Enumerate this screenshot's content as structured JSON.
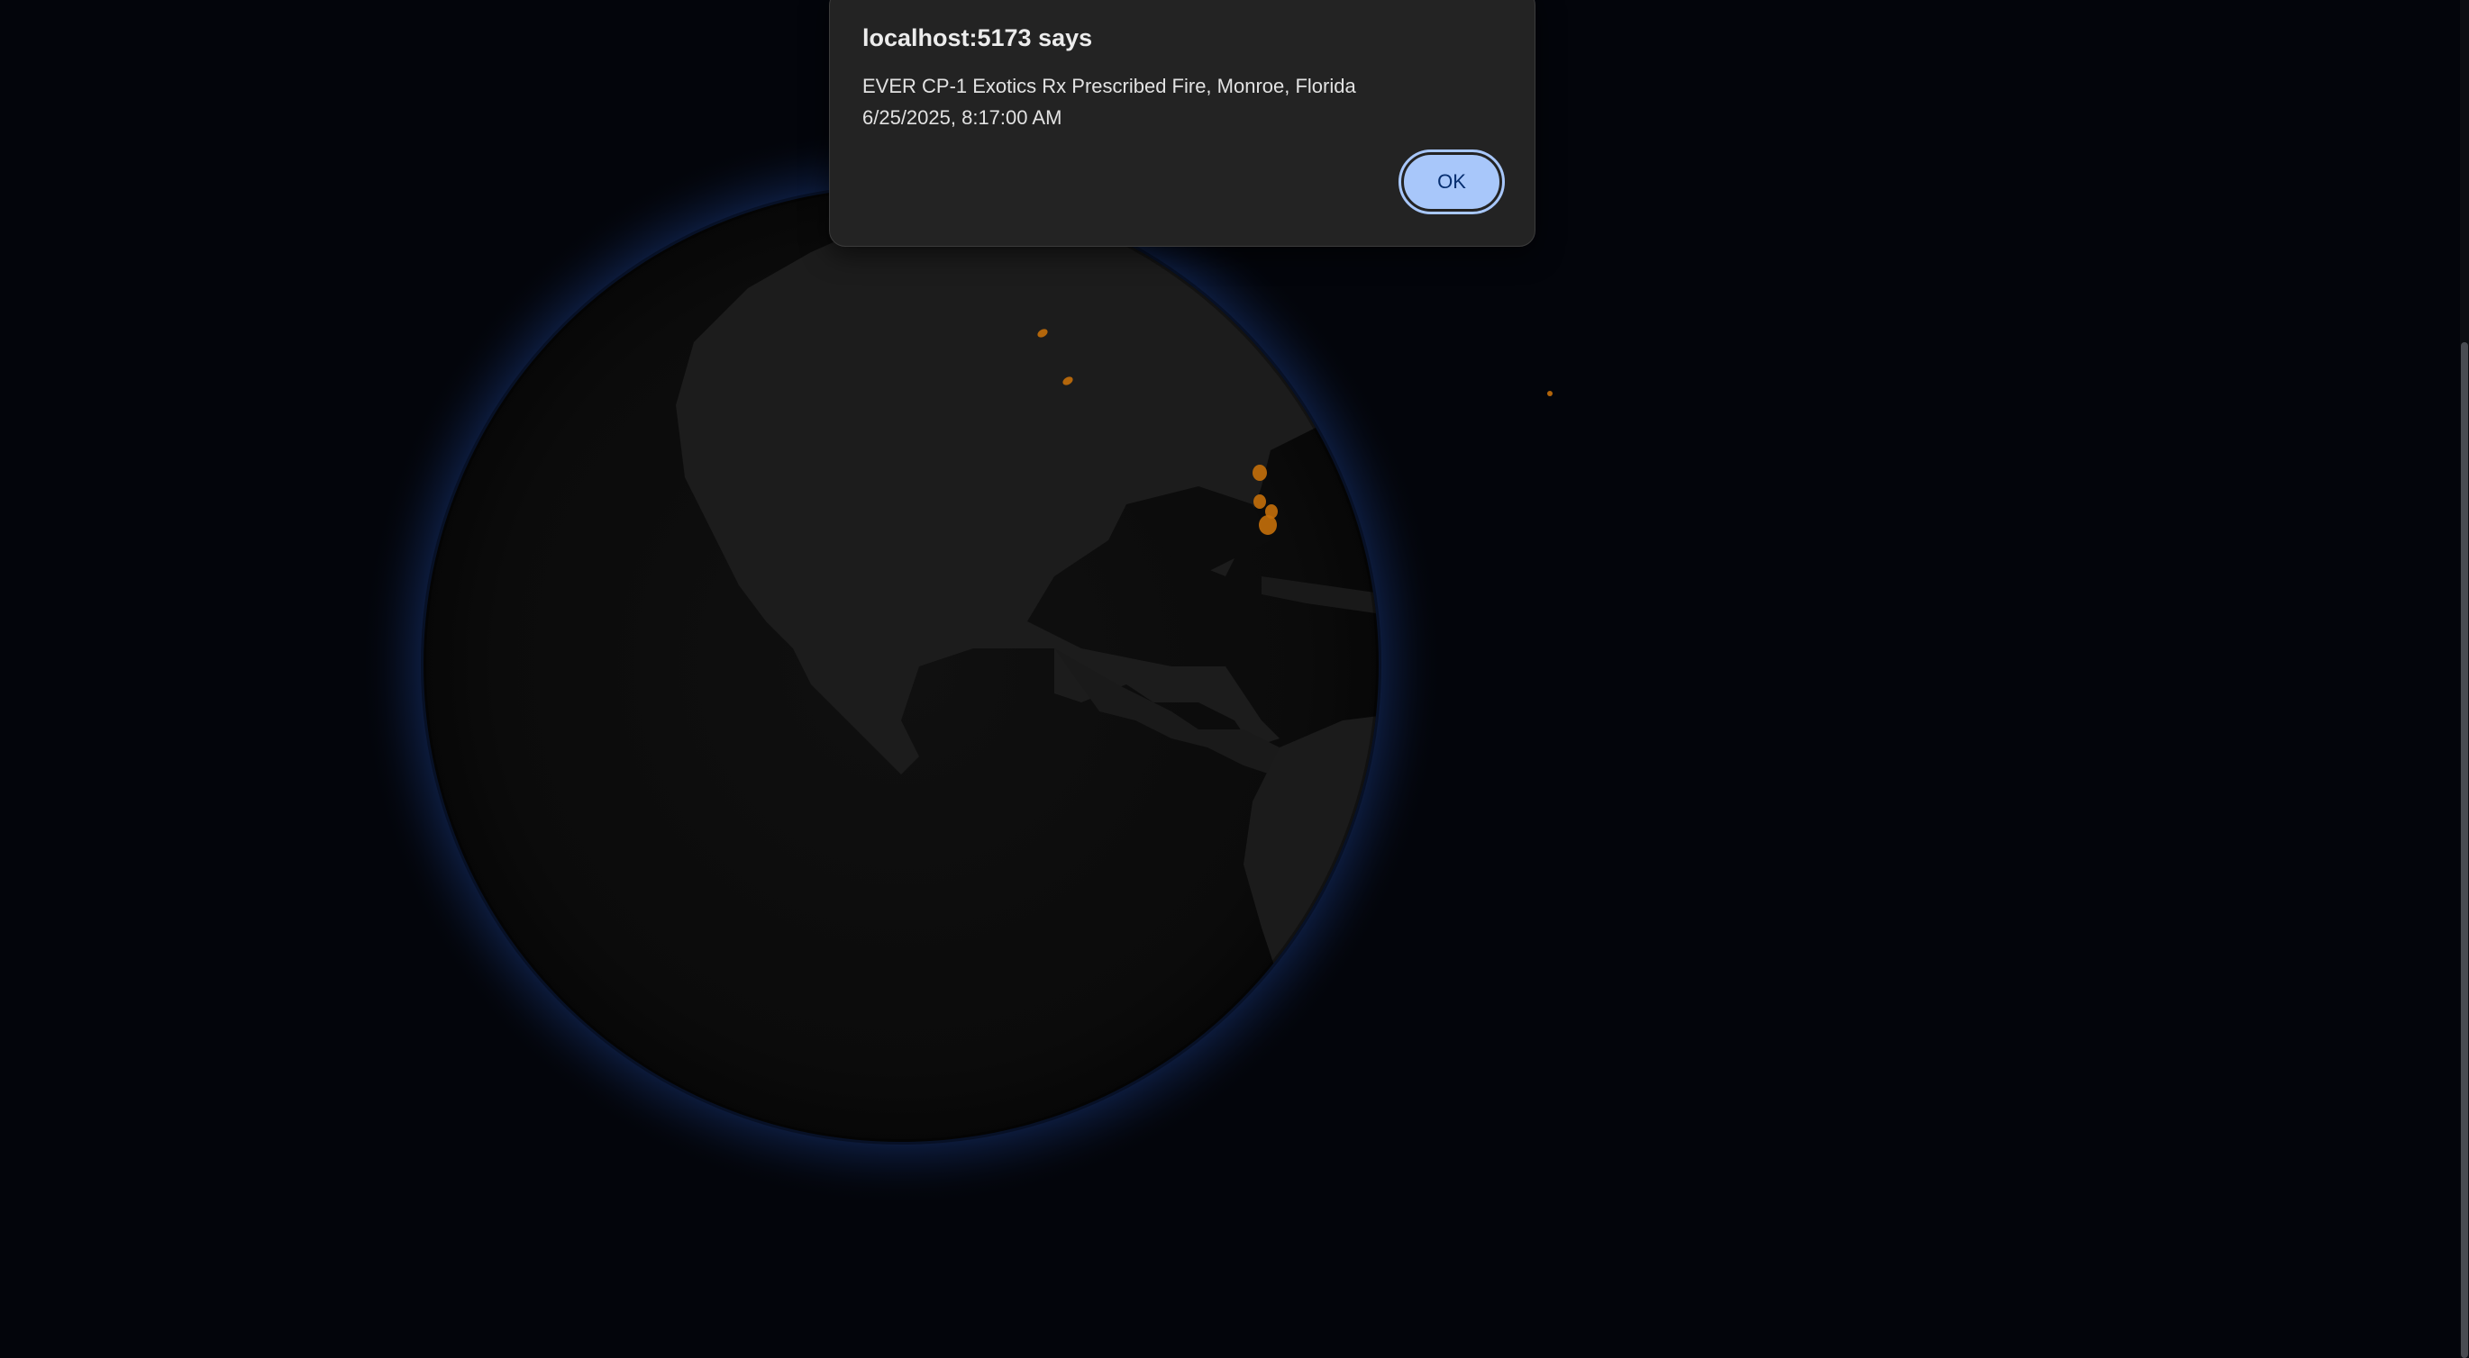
{
  "dialog": {
    "title": "localhost:5173 says",
    "message_line1": "EVER CP-1 Exotics Rx Prescribed Fire, Monroe, Florida",
    "message_line2": "6/25/2025, 8:17:00 AM",
    "ok_label": "OK"
  },
  "colors": {
    "background": "#03050b",
    "globe_ocean": "#0b0b0b",
    "globe_land": "#1d1d1d",
    "atmosphere": "#1b3e8a",
    "fire_marker": "#c46f0a",
    "dialog_bg": "#232323",
    "ok_button": "#a8c7fa"
  },
  "globe": {
    "fire_markers": [
      "fire-marker",
      "fire-marker",
      "fire-marker",
      "fire-marker",
      "fire-marker",
      "fire-marker",
      "fire-marker",
      "fire-marker"
    ]
  }
}
